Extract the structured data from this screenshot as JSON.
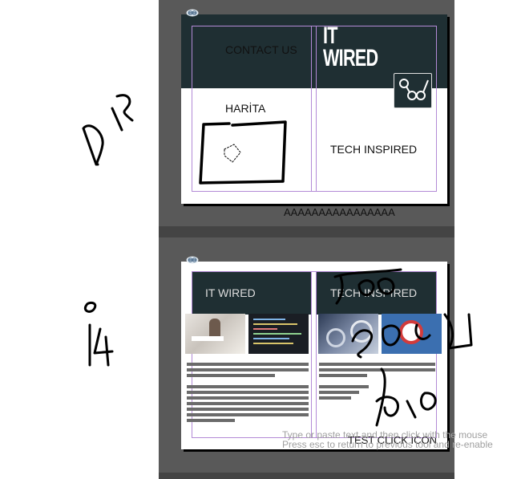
{
  "page1": {
    "contact_label": "CONTACT US",
    "logo_line1": "IT",
    "logo_line2": "WIRED",
    "harita_label": "HARİTA",
    "tech_inspired_label": "TECH INSPIRED",
    "footer_text": "AAAAAAAAAAAAAAAA"
  },
  "page2": {
    "it_wired_label": "IT WIRED",
    "tech_inspired_label": "TECH INSPIRED",
    "test_click_label": "TEST CLICK ICON"
  },
  "hint": {
    "line1": "Type or paste text and then click with the mouse",
    "line2": "Press esc to return to previous tool and re-enable"
  },
  "colors": {
    "canvas": "#595959",
    "dark_panel": "#1f2f33",
    "guides": "#b38ad6"
  },
  "icons": [
    "link-icon",
    "share-icon"
  ]
}
